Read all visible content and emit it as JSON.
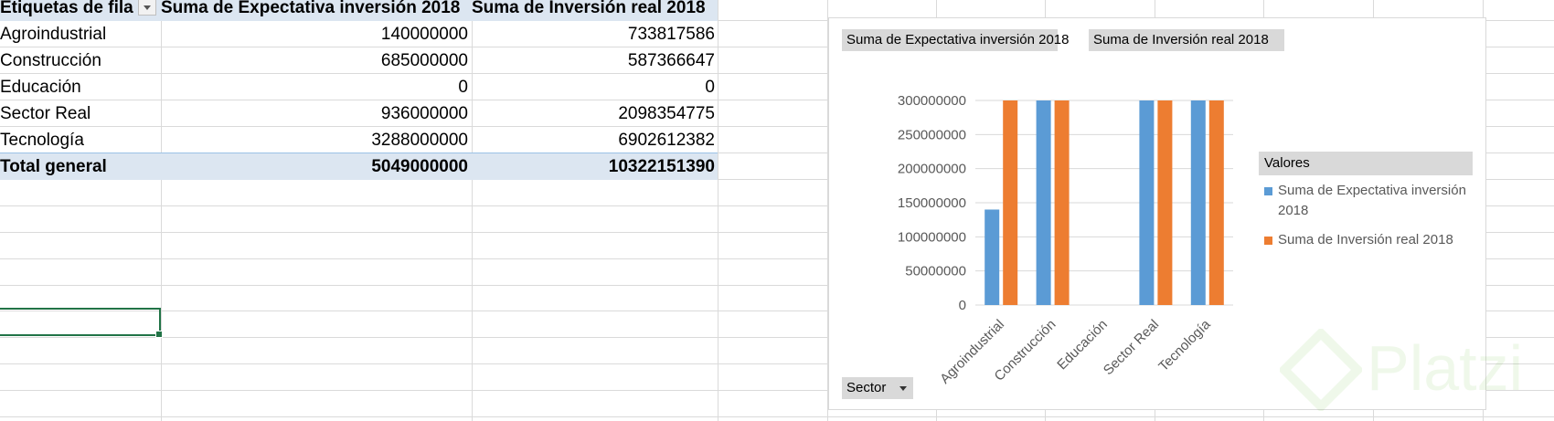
{
  "pivot_table": {
    "header": {
      "row_labels": "Etiquetas de fila",
      "col_expectativa": "Suma de Expectativa inversión 2018",
      "col_inversion": "Suma de Inversión real 2018"
    },
    "rows": [
      {
        "label": "Agroindustrial",
        "expectativa": "140000000",
        "inversion": "733817586"
      },
      {
        "label": "Construcción",
        "expectativa": "685000000",
        "inversion": "587366647"
      },
      {
        "label": "Educación",
        "expectativa": "0",
        "inversion": "0"
      },
      {
        "label": "Sector Real",
        "expectativa": "936000000",
        "inversion": "2098354775"
      },
      {
        "label": "Tecnología",
        "expectativa": "3288000000",
        "inversion": "6902612382"
      }
    ],
    "total": {
      "label": "Total general",
      "expectativa": "5049000000",
      "inversion": "10322151390"
    }
  },
  "chart": {
    "field_buttons": {
      "series1": "Suma de Expectativa inversión 2018",
      "series2": "Suma de Inversión real 2018",
      "axis_field": "Sector"
    },
    "legend_title": "Valores",
    "colors": {
      "series1": "#5b9bd5",
      "series2": "#ed7d31",
      "grid": "#d9d9d9",
      "text": "#595959"
    }
  },
  "chart_data": {
    "type": "bar",
    "categories": [
      "Agroindustrial",
      "Construcción",
      "Educación",
      "Sector Real",
      "Tecnología"
    ],
    "series": [
      {
        "name": "Suma de Expectativa inversión 2018",
        "values": [
          140000000,
          300000000,
          0,
          300000000,
          300000000
        ]
      },
      {
        "name": "Suma de Inversión real 2018",
        "values": [
          300000000,
          300000000,
          0,
          300000000,
          300000000
        ]
      }
    ],
    "ylim": [
      0,
      300000000
    ],
    "yticks": [
      "0",
      "50000000",
      "100000000",
      "150000000",
      "200000000",
      "250000000",
      "300000000"
    ],
    "grid": true,
    "legend": "right"
  },
  "watermark": {
    "text": "Platzi"
  }
}
